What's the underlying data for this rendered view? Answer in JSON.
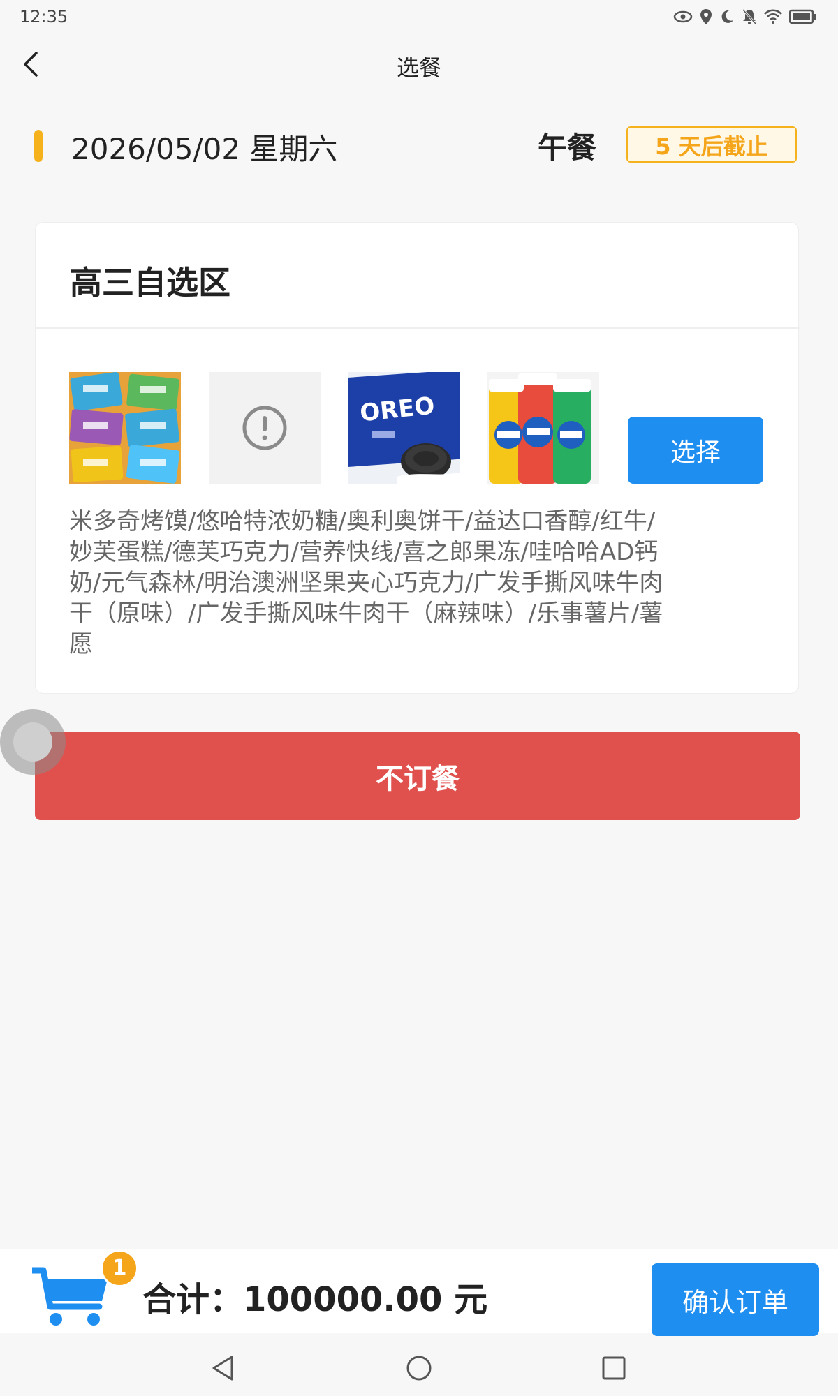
{
  "status_bar": {
    "time": "12:35"
  },
  "header": {
    "title": "选餐"
  },
  "date_row": {
    "date": "2026/05/02 星期六",
    "meal": "午餐",
    "deadline": "5 天后截止"
  },
  "card": {
    "title": "高三自选区",
    "select_label": "选择",
    "description": "米多奇烤馍/悠哈特浓奶糖/奥利奥饼干/益达口香醇/红牛/妙芙蛋糕/德芙巧克力/营养快线/喜之郎果冻/哇哈哈AD钙奶/元气森林/明治澳洲坚果夹心巧克力/广发手撕风味牛肉干（原味）/广发手撕风味牛肉干（麻辣味）/乐事薯片/薯愿",
    "thumbnails": [
      {
        "icon": "snack-package-image"
      },
      {
        "icon": "image-error-icon"
      },
      {
        "icon": "oreo-image"
      },
      {
        "icon": "gum-bottles-image"
      }
    ]
  },
  "no_order_label": "不订餐",
  "bottom_bar": {
    "cart_count": "1",
    "total": "合计：100000.00 元",
    "confirm_label": "确认订单"
  },
  "colors": {
    "accent_yellow": "#f5b21d",
    "primary_blue": "#1f8ef1",
    "danger_red": "#e0504d"
  }
}
